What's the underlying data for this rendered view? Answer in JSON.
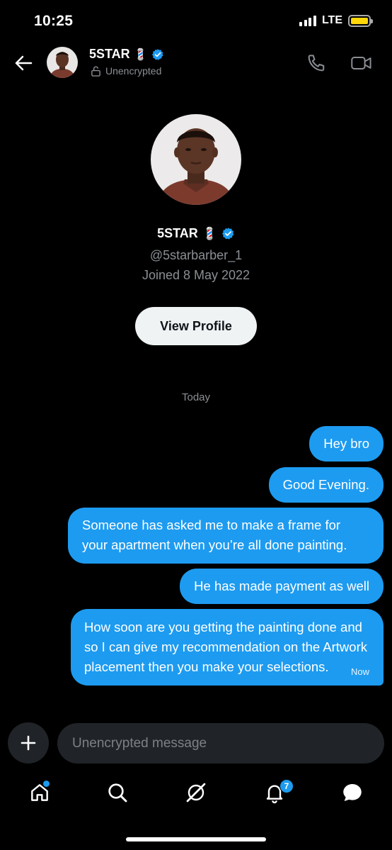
{
  "status_bar": {
    "time": "10:25",
    "network": "LTE",
    "battery_color": "#ffd60a"
  },
  "header": {
    "back_icon": "arrow-left-icon",
    "name": "5STAR",
    "name_emoji": "💈",
    "subtitle": "Unencrypted",
    "call_icon": "phone-icon",
    "video_icon": "video-icon"
  },
  "profile": {
    "name": "5STAR",
    "name_emoji": "💈",
    "handle": "@5starbarber_1",
    "joined": "Joined 8 May 2022",
    "view_profile_label": "View Profile"
  },
  "conversation": {
    "date_separator": "Today",
    "messages": [
      {
        "text": "Hey bro"
      },
      {
        "text": "Good Evening."
      },
      {
        "text": "Someone has asked me to make a frame for your apartment when you’re all done painting."
      },
      {
        "text": "He has made payment as well"
      },
      {
        "text": "How soon are you getting the painting done and so I can give my recommendation on the Artwork placement then you make your selections.",
        "time": "Now"
      }
    ]
  },
  "composer": {
    "placeholder": "Unencrypted message"
  },
  "tab_bar": {
    "items": [
      {
        "icon": "home-icon"
      },
      {
        "icon": "search-icon"
      },
      {
        "icon": "grok-icon"
      },
      {
        "icon": "bell-icon",
        "badge": "7"
      },
      {
        "icon": "messages-icon"
      }
    ]
  },
  "colors": {
    "accent": "#1d9bf0",
    "background": "#000000",
    "secondary_text": "#8b8f94",
    "verified": "#1d9bf0"
  }
}
